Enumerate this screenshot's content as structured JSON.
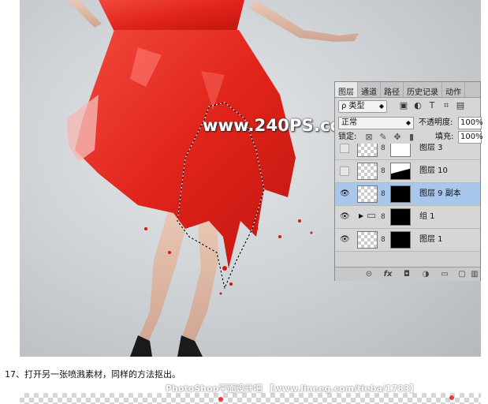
{
  "watermark": "www.240PS.com",
  "panel": {
    "tabs": [
      "图层",
      "通道",
      "路径",
      "历史记录",
      "动作"
    ],
    "kind_label": "ρ 类型",
    "blend_mode": "正常",
    "opacity_label": "不透明度:",
    "opacity_value": "100%",
    "lock_label": "锁定:",
    "fill_label": "填充:",
    "fill_value": "100%",
    "layers": [
      {
        "name": "图层 3",
        "visible": false,
        "selected": false
      },
      {
        "name": "图层 10",
        "visible": false,
        "selected": false
      },
      {
        "name": "图层 9 副本",
        "visible": true,
        "selected": true
      },
      {
        "name": "组 1",
        "visible": true,
        "selected": false
      },
      {
        "name": "图层 1",
        "visible": true,
        "selected": false
      }
    ],
    "footer_icons": [
      "link-icon",
      "fx-icon",
      "mask-icon",
      "adjustment-icon",
      "folder-icon",
      "new-layer-icon",
      "trash-icon"
    ]
  },
  "caption": "17、打开另一张喷溅素材，同样的方法抠出。",
  "footer_watermark": "PhotoShop平面设计吧 【www.lineeg.com/tieba/1783】",
  "colors": {
    "dress": "#e8251c",
    "selection": "#a9c6ec"
  }
}
